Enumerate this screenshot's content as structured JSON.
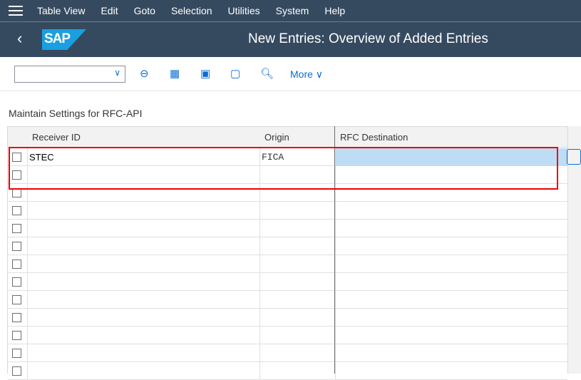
{
  "menu": [
    "Table View",
    "Edit",
    "Goto",
    "Selection",
    "Utilities",
    "System",
    "Help"
  ],
  "title": "New Entries: Overview of Added Entries",
  "logo": "SAP",
  "toolbar": {
    "more": "More"
  },
  "section_title": "Maintain Settings for RFC-API",
  "columns": [
    "Receiver ID",
    "Origin",
    "RFC Destination"
  ],
  "rows": [
    [
      "STEC",
      "FICA",
      ""
    ],
    [
      "",
      "",
      ""
    ],
    [
      "",
      "",
      ""
    ],
    [
      "",
      "",
      ""
    ],
    [
      "",
      "",
      ""
    ],
    [
      "",
      "",
      ""
    ],
    [
      "",
      "",
      ""
    ],
    [
      "",
      "",
      ""
    ],
    [
      "",
      "",
      ""
    ],
    [
      "",
      "",
      ""
    ],
    [
      "",
      "",
      ""
    ],
    [
      "",
      "",
      ""
    ],
    [
      "",
      "",
      ""
    ]
  ]
}
